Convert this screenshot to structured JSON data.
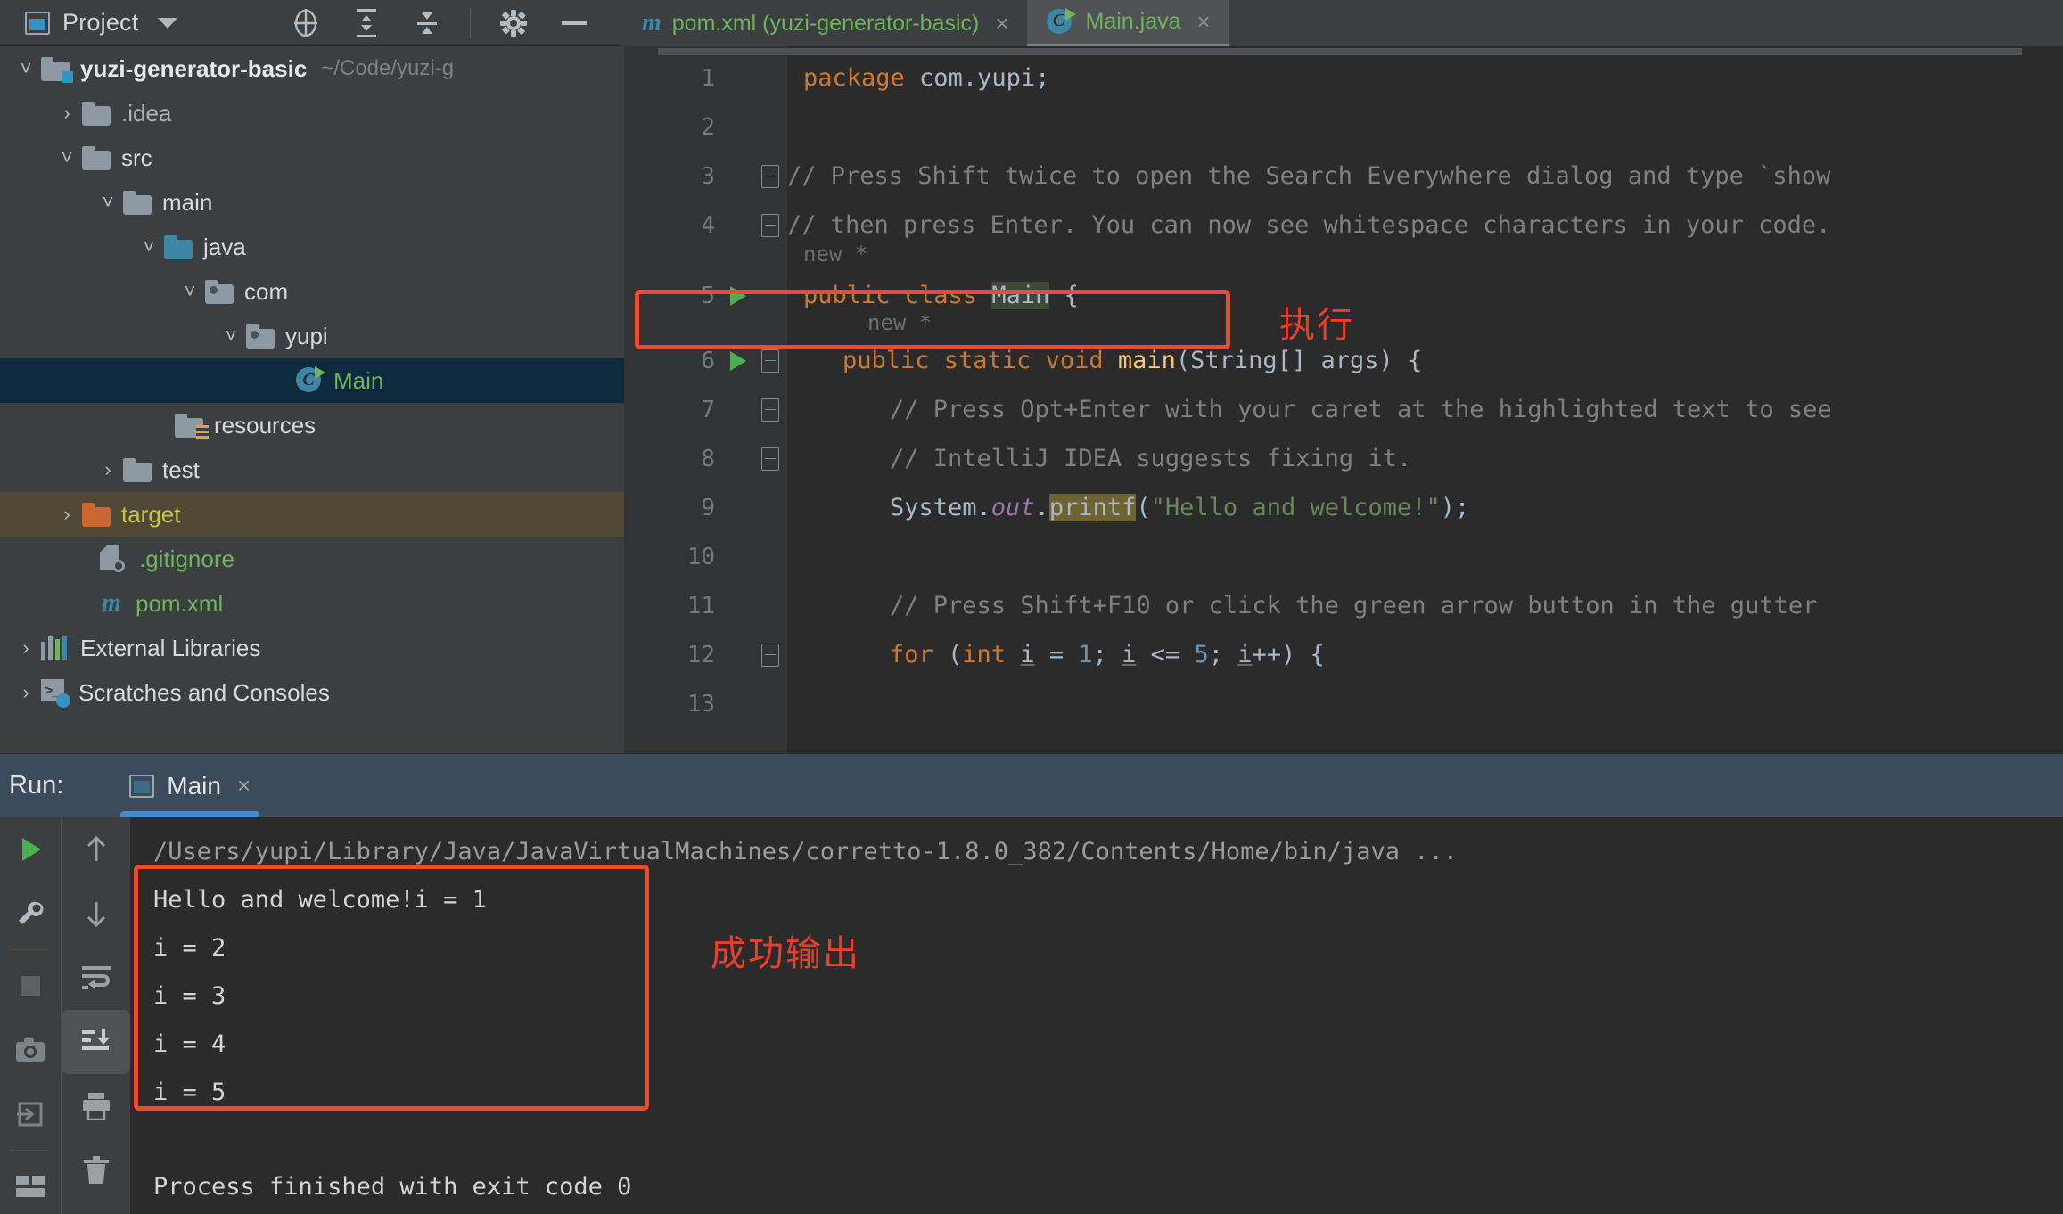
{
  "topbar": {
    "project_label": "Project",
    "icons": [
      "locate-icon",
      "expand-all-icon",
      "collapse-all-icon",
      "gear-icon",
      "minimize-icon"
    ]
  },
  "project_tree": {
    "items": [
      {
        "label": "yuzi-generator-basic",
        "path_hint": "~/Code/yuzi-g",
        "icon": "folder-module-icon",
        "indent": 0,
        "arrow": "down",
        "style": "bold",
        "selected": false
      },
      {
        "label": ".idea",
        "icon": "folder-icon",
        "indent": 1,
        "arrow": "right",
        "style": "dim",
        "selected": false
      },
      {
        "label": "src",
        "icon": "folder-icon",
        "indent": 1,
        "arrow": "down",
        "style": "normal",
        "selected": false
      },
      {
        "label": "main",
        "icon": "folder-icon",
        "indent": 2,
        "arrow": "down",
        "style": "normal",
        "selected": false
      },
      {
        "label": "java",
        "icon": "folder-source-icon",
        "indent": 3,
        "arrow": "down",
        "style": "normal",
        "selected": false
      },
      {
        "label": "com",
        "icon": "folder-package-icon",
        "indent": 4,
        "arrow": "down",
        "style": "normal",
        "selected": false
      },
      {
        "label": "yupi",
        "icon": "folder-package-icon",
        "indent": 5,
        "arrow": "down",
        "style": "normal",
        "selected": false
      },
      {
        "label": "Main",
        "icon": "java-class-runnable-icon",
        "indent": 6,
        "arrow": "none",
        "style": "green",
        "selected": true
      },
      {
        "label": "resources",
        "icon": "folder-resources-icon",
        "indent": 4,
        "arrow": "none",
        "style": "normal",
        "selected": false
      },
      {
        "label": "test",
        "icon": "folder-icon",
        "indent": 2,
        "arrow": "right",
        "style": "normal",
        "selected": false
      },
      {
        "label": "target",
        "icon": "folder-excluded-icon",
        "indent": 1,
        "arrow": "right",
        "style": "yellow",
        "selected": false,
        "highlight": "amber"
      },
      {
        "label": ".gitignore",
        "icon": "gitignore-file-icon",
        "indent": 2,
        "arrow": "none",
        "style": "green",
        "selected": false
      },
      {
        "label": "pom.xml",
        "icon": "maven-file-icon",
        "indent": 2,
        "arrow": "none",
        "style": "green",
        "selected": false
      },
      {
        "label": "External Libraries",
        "icon": "libraries-icon",
        "indent": 0,
        "arrow": "right",
        "style": "normal",
        "selected": false
      },
      {
        "label": "Scratches and Consoles",
        "icon": "scratches-icon",
        "indent": 0,
        "arrow": "right",
        "style": "normal",
        "selected": false
      }
    ]
  },
  "editor": {
    "tabs": [
      {
        "label": "pom.xml (yuzi-generator-basic)",
        "icon": "maven-file-icon",
        "active": false,
        "close": "×"
      },
      {
        "label": "Main.java",
        "icon": "java-class-runnable-icon",
        "active": true,
        "close": "×"
      }
    ],
    "lines": [
      {
        "num": "1",
        "kind": "code"
      },
      {
        "num": "2",
        "kind": "code"
      },
      {
        "num": "3",
        "kind": "code"
      },
      {
        "num": "4",
        "kind": "code"
      },
      {
        "num": "5",
        "kind": "code"
      },
      {
        "num": "6",
        "kind": "code"
      },
      {
        "num": "7",
        "kind": "code"
      },
      {
        "num": "8",
        "kind": "code"
      },
      {
        "num": "9",
        "kind": "code"
      },
      {
        "num": "10",
        "kind": "code"
      },
      {
        "num": "11",
        "kind": "code"
      },
      {
        "num": "12",
        "kind": "code"
      },
      {
        "num": "13",
        "kind": "code"
      }
    ],
    "source": {
      "l1_package_kw": "package",
      "l1_name": " com.yupi;",
      "l3": "// Press Shift twice to open the Search Everywhere dialog and type `show",
      "l4": "// then press Enter. You can now see whitespace characters in your code.",
      "l5_a": "public class ",
      "l5_b": "Main",
      "l5_c": " {",
      "l6_a": "public static void ",
      "l6_b": "main",
      "l6_c": "(String[] args) {",
      "l7": "// Press Opt+Enter with your caret at the highlighted text to see",
      "l8": "// IntelliJ IDEA suggests fixing it.",
      "l9_a": "System.",
      "l9_b": "out",
      "l9_c": ".",
      "l9_d": "printf",
      "l9_e": "(",
      "l9_f": "\"Hello and welcome!\"",
      "l9_g": ");",
      "l11": "// Press Shift+F10 or click the green arrow button in the gutter",
      "l12_for": "for ",
      "l12_a": "(",
      "l12_int": "int ",
      "l12_i1": "i",
      "l12_eq": " = ",
      "l12_n1": "1",
      "l12_s1": "; ",
      "l12_i2": "i",
      "l12_le": " <= ",
      "l12_n2": "5",
      "l12_s2": "; ",
      "l12_i3": "i",
      "l12_inc": "++) {"
    },
    "inlay_new": "new *"
  },
  "annotations": [
    {
      "text": "执行",
      "meaning": "execute"
    },
    {
      "text": "成功输出",
      "meaning": "successful output"
    }
  ],
  "run_panel": {
    "label": "Run:",
    "tab_label": "Main",
    "tab_close": "×",
    "toolbar_left": [
      "rerun-play-icon",
      "settings-wrench-icon",
      "stop-icon",
      "camera-icon",
      "export-icon",
      "layout-icon"
    ],
    "toolbar_right": [
      "scroll-up-icon",
      "scroll-down-icon",
      "soft-wrap-icon",
      "scroll-to-end-icon",
      "print-icon",
      "trash-icon"
    ],
    "console": {
      "jvm_path": "/Users/yupi/Library/Java/JavaVirtualMachines/corretto-1.8.0_382/Contents/Home/bin/java ...",
      "output_lines": [
        "Hello and welcome!i = 1",
        "i = 2",
        "i = 3",
        "i = 4",
        "i = 5"
      ],
      "exit_line": "Process finished with exit code 0"
    }
  },
  "colors": {
    "accent_blue": "#4a88c7",
    "annotation_red": "#e8402a",
    "selection_navy": "#0d293e",
    "keyword_orange": "#cc7832",
    "string_green": "#6a8759",
    "comment_gray": "#808080",
    "editor_bg": "#2b2b2b",
    "panel_bg": "#3c3f41"
  }
}
